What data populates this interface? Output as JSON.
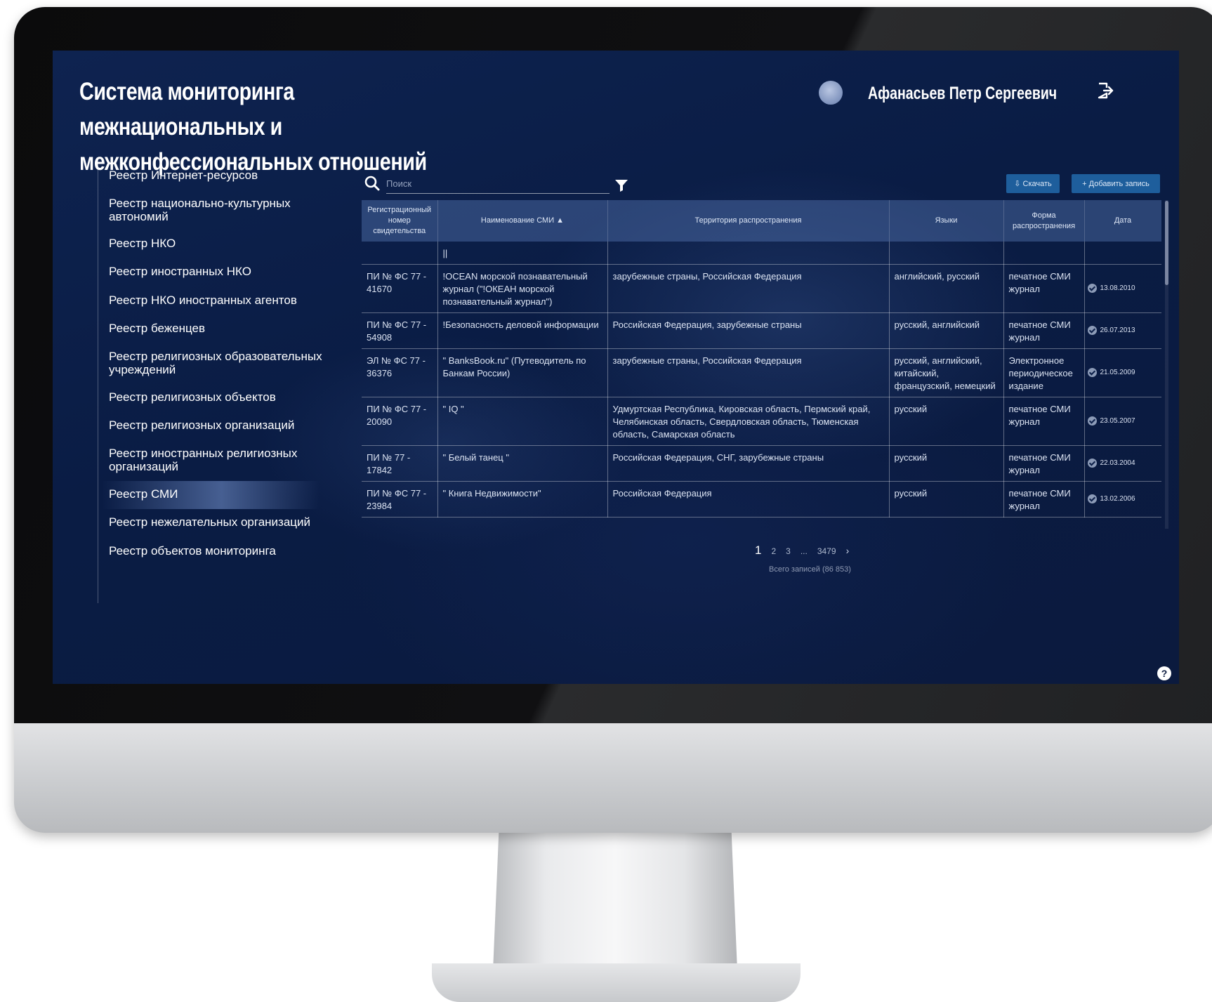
{
  "app": {
    "title_line1": "Система мониторинга межнациональных и",
    "title_line2": "межконфессиональных отношений",
    "user_name": "Афанасьев Петр Сергеевич"
  },
  "sidebar": {
    "active_index": 11,
    "items": [
      {
        "label": "Реестр Интернет-ресурсов"
      },
      {
        "label": "Реестр национально-культурных автономий"
      },
      {
        "label": "Реестр НКО"
      },
      {
        "label": "Реестр иностранных НКО"
      },
      {
        "label": "Реестр НКО иностранных агентов"
      },
      {
        "label": "Реестр беженцев"
      },
      {
        "label": "Реестр религиозных образовательных учреждений"
      },
      {
        "label": "Реестр религиозных объектов"
      },
      {
        "label": "Реестр религиозных организаций"
      },
      {
        "label": "Реестр иностранных религиозных организаций"
      },
      {
        "label": "Реестр СМИ"
      },
      {
        "label": "Реестр нежелательных организаций"
      },
      {
        "label": "Реестр объектов мониторинга"
      }
    ]
  },
  "toolbar": {
    "search_placeholder": "Поиск",
    "download_label": "⇩ Скачать",
    "add_label": "+ Добавить запись"
  },
  "table": {
    "headers": [
      "Регистрационный номер свидетельства",
      "Наименование СМИ ▲",
      "Территория распространения",
      "Языки",
      "Форма распространения",
      "Дата"
    ],
    "filter_row": [
      "",
      "||",
      "",
      "",
      "",
      ""
    ],
    "rows": [
      [
        "ПИ № ФС 77 - 41670",
        "!OCEAN морской познавательный журнал (\"!ОКЕАН морской познавательный журнал\")",
        "зарубежные страны, Российская Федерация",
        "английский, русский",
        "печатное СМИ журнал",
        "13.08.2010"
      ],
      [
        "ПИ № ФС 77 - 54908",
        "!Безопасность деловой информации",
        "Российская Федерация, зарубежные страны",
        "русский, английский",
        "печатное СМИ журнал",
        "26.07.2013"
      ],
      [
        "ЭЛ № ФС 77 - 36376",
        "\" BanksBook.ru\" (Путеводитель по Банкам России)",
        "зарубежные страны, Российская Федерация",
        "русский, английский, китайский, французский, немецкий",
        "Электронное периодическое издание",
        "21.05.2009"
      ],
      [
        "ПИ № ФС 77 - 20090",
        "\" IQ \"",
        "Удмуртская Республика, Кировская область, Пермский край, Челябинская область, Свердловская область, Тюменская область, Самарская область",
        "русский",
        "печатное СМИ журнал",
        "23.05.2007"
      ],
      [
        "ПИ № 77 - 17842",
        "\" Белый танец \"",
        "Российская Федерация, СНГ, зарубежные страны",
        "русский",
        "печатное СМИ журнал",
        "22.03.2004"
      ],
      [
        "ПИ № ФС 77 - 23984",
        "\" Книга Недвижимости\"",
        "Российская Федерация",
        "русский",
        "печатное СМИ журнал",
        "13.02.2006"
      ]
    ]
  },
  "pagination": {
    "pages": [
      "1",
      "2",
      "3",
      "...",
      "3479"
    ],
    "next": "›",
    "total": "Всего записей (86 853)"
  },
  "colors": {
    "background": "#0b1a3e",
    "button": "#1e5e9c",
    "header_row": "#3f5a8c"
  }
}
